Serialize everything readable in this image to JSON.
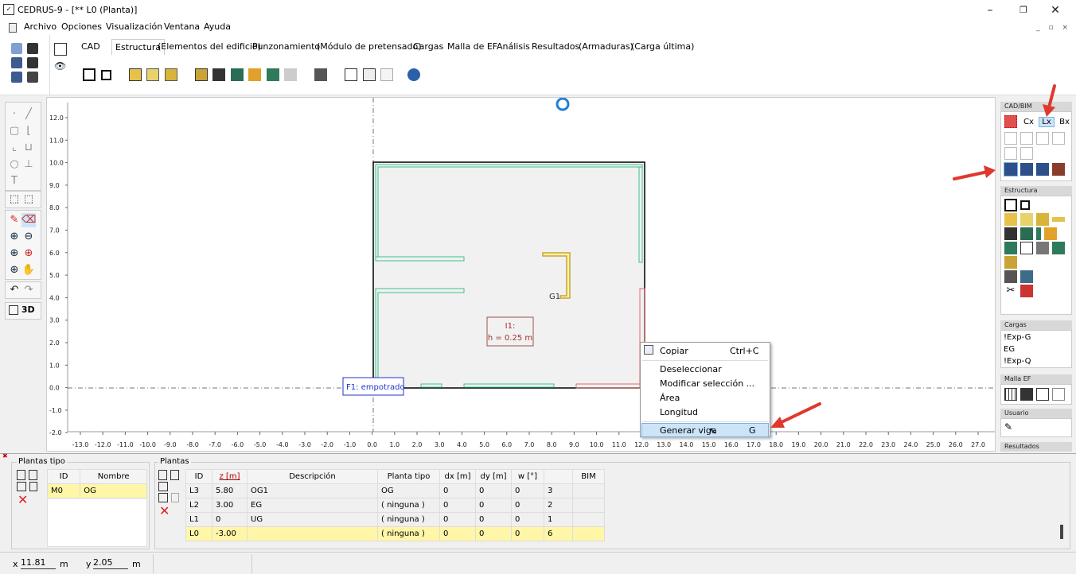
{
  "window": {
    "title": "CEDRUS-9 - [** L0  (Planta)]",
    "icon": "cedrus-icon"
  },
  "menu": [
    "Archivo",
    "Opciones",
    "Visualización",
    "Ventana",
    "Ayuda"
  ],
  "tabs": [
    "CAD",
    "Estructura",
    "(Elementos del edificio)",
    "Punzonamiento",
    "(Módulo de pretensado)",
    "Cargas",
    "Malla de EF",
    "Análisis",
    "Resultados",
    "(Armaduras)",
    "(Carga última)"
  ],
  "active_tab": "Estructura",
  "view_toggle": "3D",
  "canvas": {
    "y_ticks": [
      "12.0",
      "11.0",
      "10.0",
      "9.0",
      "8.0",
      "7.0",
      "6.0",
      "5.0",
      "4.0",
      "3.0",
      "2.0",
      "1.0",
      "0.0",
      "-1.0",
      "-2.0"
    ],
    "x_ticks": [
      "-13.0",
      "-12.0",
      "-11.0",
      "-10.0",
      "-9.0",
      "-8.0",
      "-7.0",
      "-6.0",
      "-5.0",
      "-4.0",
      "-3.0",
      "-2.0",
      "-1.0",
      "0.0",
      "1.0",
      "2.0",
      "3.0",
      "4.0",
      "5.0",
      "6.0",
      "7.0",
      "8.0",
      "9.0",
      "10.0",
      "11.0",
      "12.0",
      "13.0",
      "14.0",
      "15.0",
      "16.0",
      "17.0",
      "18.0",
      "19.0",
      "20.0",
      "21.0",
      "22.0",
      "23.0",
      "24.0",
      "25.0",
      "26.0",
      "27.0"
    ],
    "slab_label_line1": "I1:",
    "slab_label_line2": "h = 0.25 m",
    "foundation_label": "F1: empotrado",
    "core_label": "G1"
  },
  "context_menu": {
    "items": [
      {
        "label": "Copiar",
        "shortcut": "Ctrl+C"
      },
      {
        "label": "Deseleccionar",
        "shortcut": ""
      },
      {
        "label": "Modificar selección ...",
        "shortcut": ""
      },
      {
        "label": "Área",
        "shortcut": ""
      },
      {
        "label": "Longitud",
        "shortcut": ""
      },
      {
        "label": "Generar viga",
        "shortcut": "G"
      }
    ],
    "highlighted": "Generar viga"
  },
  "right_panel": {
    "cad_bim": {
      "header": "CAD/BIM",
      "buttons": [
        "Cx",
        "Lx",
        "Bx"
      ]
    },
    "estructura": {
      "header": "Estructura"
    },
    "cargas": {
      "header": "Cargas",
      "items": [
        "!Exp-G",
        "EG",
        "!Exp-Q"
      ]
    },
    "malla": {
      "header": "Malla EF"
    },
    "usuario": {
      "header": "Usuario"
    },
    "resultados": {
      "header": "Resultados"
    }
  },
  "plantas_tipo": {
    "title": "Plantas tipo",
    "columns": [
      "ID",
      "Nombre"
    ],
    "rows": [
      [
        "M0",
        "OG"
      ]
    ]
  },
  "plantas": {
    "title": "Plantas",
    "columns": [
      "ID",
      "z [m]",
      "Descripción",
      "Planta tipo",
      "dx [m]",
      "dy [m]",
      "w [°]",
      "",
      "BIM"
    ],
    "rows": [
      [
        "L3",
        "5.80",
        "OG1",
        "OG",
        "0",
        "0",
        "0",
        "3",
        ""
      ],
      [
        "L2",
        "3.00",
        "EG",
        "( ninguna )",
        "0",
        "0",
        "0",
        "2",
        ""
      ],
      [
        "L1",
        "0",
        "UG",
        "( ninguna )",
        "0",
        "0",
        "0",
        "1",
        ""
      ],
      [
        "L0",
        "-3.00",
        "",
        "( ninguna )",
        "0",
        "0",
        "0",
        "6",
        ""
      ]
    ]
  },
  "status": {
    "x_label": "x",
    "x_value": "11.81",
    "x_unit": "m",
    "y_label": "y",
    "y_value": "2.05",
    "y_unit": "m"
  },
  "colors": {
    "accent_red": "#e0382f",
    "highlight_yellow": "#fff6a8",
    "selection_blue": "#cce4f7",
    "wall_green": "#3cc28a"
  }
}
